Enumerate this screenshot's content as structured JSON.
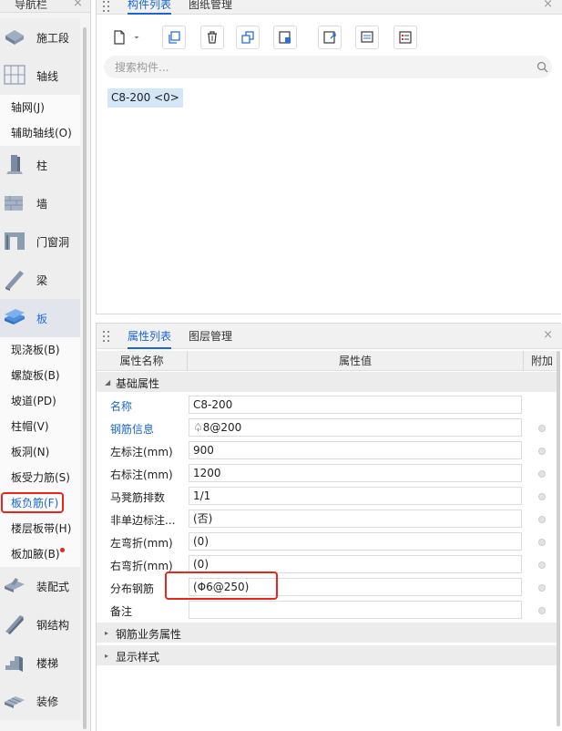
{
  "nav": {
    "title": "导航栏",
    "close_glyph": "×",
    "items": [
      {
        "type": "category",
        "label": "施工段",
        "icon": "construction-stage-icon"
      },
      {
        "type": "category",
        "label": "轴线",
        "icon": "axis-grid-icon"
      },
      {
        "type": "sub",
        "label": "轴网(J)"
      },
      {
        "type": "sub",
        "label": "辅助轴线(O)"
      },
      {
        "type": "category",
        "label": "柱",
        "icon": "column-icon"
      },
      {
        "type": "category",
        "label": "墙",
        "icon": "wall-icon"
      },
      {
        "type": "category",
        "label": "门窗洞",
        "icon": "door-window-icon"
      },
      {
        "type": "category",
        "label": "梁",
        "icon": "beam-icon"
      },
      {
        "type": "category",
        "label": "板",
        "icon": "slab-icon",
        "active": true
      },
      {
        "type": "sub",
        "label": "现浇板(B)"
      },
      {
        "type": "sub",
        "label": "螺旋板(B)"
      },
      {
        "type": "sub",
        "label": "坡道(PD)"
      },
      {
        "type": "sub",
        "label": "柱帽(V)"
      },
      {
        "type": "sub",
        "label": "板洞(N)"
      },
      {
        "type": "sub",
        "label": "板受力筋(S)"
      },
      {
        "type": "sub",
        "label": "板负筋(F)",
        "selected": true
      },
      {
        "type": "sub",
        "label": "楼层板带(H)"
      },
      {
        "type": "sub",
        "label": "板加腋(B)",
        "dot": true
      },
      {
        "type": "category",
        "label": "装配式",
        "icon": "prefab-icon"
      },
      {
        "type": "category",
        "label": "钢结构",
        "icon": "steel-structure-icon"
      },
      {
        "type": "category",
        "label": "楼梯",
        "icon": "stair-icon"
      },
      {
        "type": "category",
        "label": "装修",
        "icon": "decoration-icon"
      }
    ]
  },
  "component_panel": {
    "tabs": [
      "构件列表",
      "图纸管理"
    ],
    "active_tab": 0,
    "close_glyph": "×",
    "toolbar": [
      "new-component",
      "dropdown",
      "copy-component",
      "delete-component",
      "layer-copy",
      "import",
      "export",
      "paste-settings",
      "properties-list"
    ],
    "search_placeholder": "搜索构件...",
    "items": [
      "C8-200 <0>"
    ]
  },
  "property_panel": {
    "tabs": [
      "属性列表",
      "图层管理"
    ],
    "active_tab": 0,
    "close_glyph": "×",
    "columns": [
      "属性名称",
      "属性值",
      "附加"
    ],
    "group_basic": "基础属性",
    "rows": [
      {
        "name": "名称",
        "value": "C8-200",
        "blue": true,
        "addon": false
      },
      {
        "name": "钢筋信息",
        "value": "♤8@200",
        "blue": true,
        "addon": true
      },
      {
        "name": "左标注(mm)",
        "value": "900",
        "blue": false,
        "addon": true
      },
      {
        "name": "右标注(mm)",
        "value": "1200",
        "blue": false,
        "addon": true
      },
      {
        "name": "马凳筋排数",
        "value": "1/1",
        "blue": false,
        "addon": true
      },
      {
        "name": "非单边标注...",
        "value": "(否)",
        "blue": false,
        "addon": true
      },
      {
        "name": "左弯折(mm)",
        "value": "(0)",
        "blue": false,
        "addon": true
      },
      {
        "name": "右弯折(mm)",
        "value": "(0)",
        "blue": false,
        "addon": true
      },
      {
        "name": "分布钢筋",
        "value": "(Φ6@250)",
        "blue": false,
        "addon": true
      },
      {
        "name": "备注",
        "value": "",
        "blue": false,
        "addon": true
      }
    ],
    "group_rebar_business": "钢筋业务属性",
    "group_display": "显示样式"
  },
  "colors": {
    "accent": "#1a66d4",
    "highlight_box": "#e8261c",
    "selected_item_bg": "#d5e6f7"
  }
}
